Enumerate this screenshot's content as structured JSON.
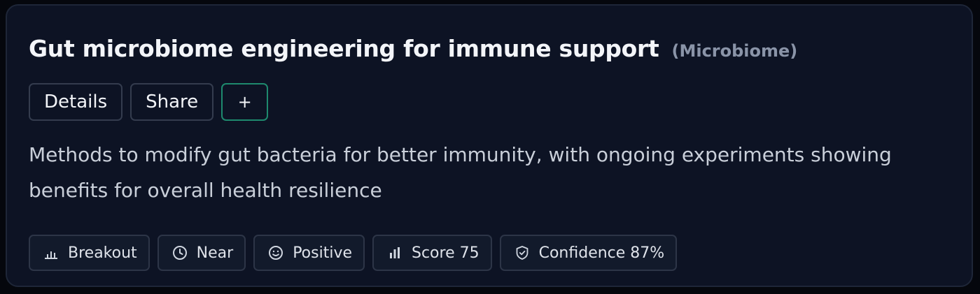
{
  "card": {
    "title": "Gut microbiome engineering for immune support",
    "category": "(Microbiome)",
    "actions": {
      "details_label": "Details",
      "share_label": "Share",
      "add_label": "+"
    },
    "description": "Methods to modify gut bacteria for better immunity, with ongoing experiments showing benefits for overall health resilience",
    "tags": [
      {
        "icon": "chart-bars-icon",
        "label": "Breakout"
      },
      {
        "icon": "clock-icon",
        "label": "Near"
      },
      {
        "icon": "smiley-icon",
        "label": "Positive"
      },
      {
        "icon": "bar-chart-icon",
        "label": "Score 75"
      },
      {
        "icon": "shield-icon",
        "label": "Confidence 87%"
      }
    ]
  },
  "colors": {
    "background": "#0d1324",
    "accent_border": "#1e8a6e",
    "title": "#f3f5f9",
    "muted": "#8a94a8"
  }
}
